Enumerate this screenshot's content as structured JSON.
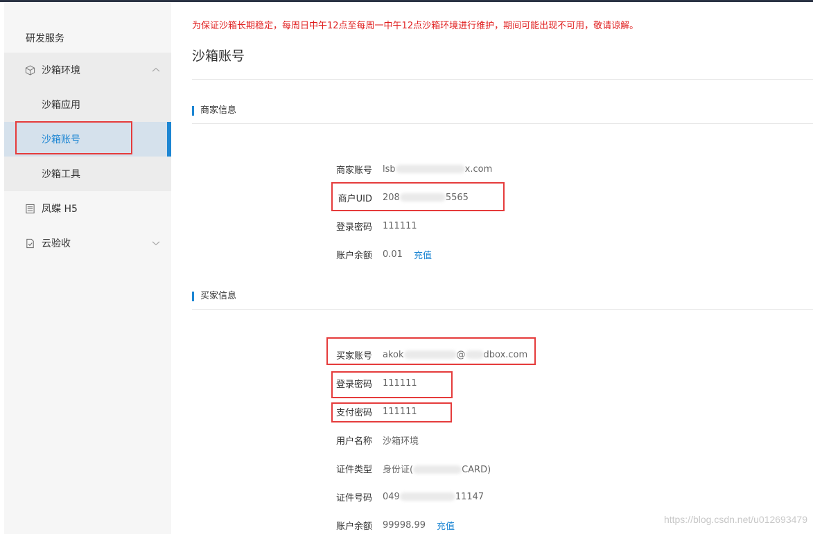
{
  "notice": "为保证沙箱长期稳定，每周日中午12点至每周一中午12点沙箱环境进行维护，期间可能出现不可用，敬请谅解。",
  "page_title": "沙箱账号",
  "sidebar": {
    "header": "研发服务",
    "items": [
      {
        "label": "沙箱环境",
        "icon": "cube-icon",
        "expanded": true
      },
      {
        "label": "沙箱应用"
      },
      {
        "label": "沙箱账号",
        "active": true
      },
      {
        "label": "沙箱工具"
      },
      {
        "label": "凤蝶 H5",
        "icon": "layout-icon"
      },
      {
        "label": "云验收",
        "icon": "document-check-icon",
        "expanded": false
      }
    ]
  },
  "merchant": {
    "title": "商家信息",
    "account_label": "商家账号",
    "account_prefix": "lsb",
    "account_suffix": "x.com",
    "uid_label": "商户UID",
    "uid_prefix": "208",
    "uid_suffix": "5565",
    "password_label": "登录密码",
    "password": "111111",
    "balance_label": "账户余额",
    "balance": "0.01",
    "recharge": "充值"
  },
  "buyer": {
    "title": "买家信息",
    "account_label": "买家账号",
    "account_prefix": "akok",
    "account_at": "@",
    "account_suffix": "dbox.com",
    "login_password_label": "登录密码",
    "login_password": "111111",
    "pay_password_label": "支付密码",
    "pay_password": "111111",
    "name_label": "用户名称",
    "name": "沙箱环境",
    "id_type_label": "证件类型",
    "id_type_prefix": "身份证(",
    "id_type_suffix": "CARD)",
    "id_no_label": "证件号码",
    "id_no_prefix": "049",
    "id_no_suffix": "11147",
    "balance_label": "账户余额",
    "balance": "99998.99",
    "recharge": "充值"
  },
  "watermark": "https://blog.csdn.net/u012693479",
  "colors": {
    "accent": "#1d86d3",
    "annotation": "#e53b3b",
    "notice": "#e02020"
  }
}
